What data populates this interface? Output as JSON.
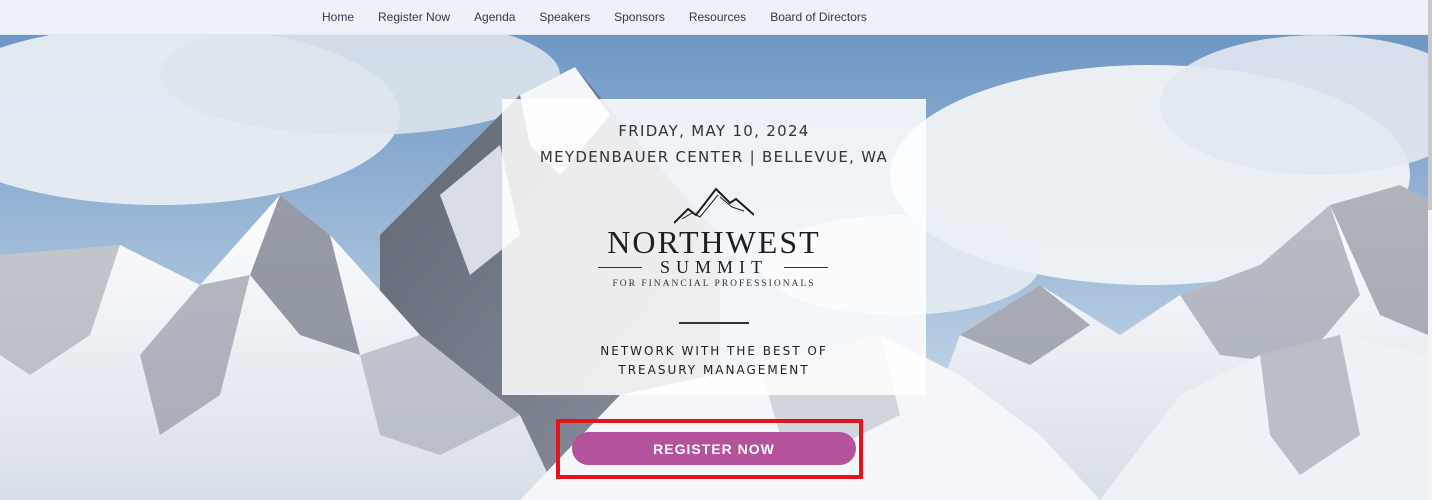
{
  "nav": {
    "items": [
      {
        "label": "Home"
      },
      {
        "label": "Register Now"
      },
      {
        "label": "Agenda"
      },
      {
        "label": "Speakers"
      },
      {
        "label": "Sponsors"
      },
      {
        "label": "Resources"
      },
      {
        "label": "Board of Directors"
      }
    ]
  },
  "hero": {
    "date": "FRIDAY, MAY 10, 2024",
    "venue": "MEYDENBAUER CENTER | BELLEVUE, WA",
    "logo": {
      "title": "NORTHWEST",
      "subtitle": "SUMMIT",
      "tagline": "FOR FINANCIAL PROFESSIONALS",
      "icon": "mountain-peaks-icon"
    },
    "tagline_line1": "NETWORK WITH THE BEST OF",
    "tagline_line2": "TREASURY MANAGEMENT",
    "register_label": "REGISTER NOW"
  },
  "colors": {
    "nav_bg": "#eef2f8",
    "button": "#b4529c",
    "highlight": "#e2141c",
    "sky": "#7aa0c8",
    "snow": "#f2f4f8"
  }
}
